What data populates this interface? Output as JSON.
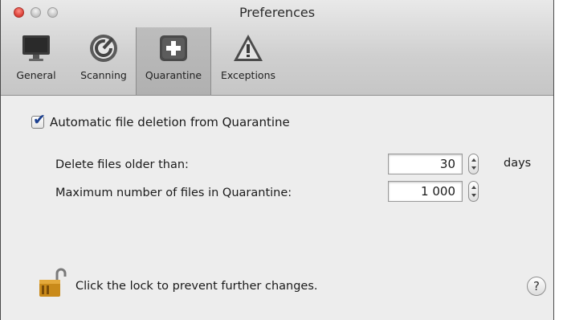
{
  "window": {
    "title": "Preferences"
  },
  "toolbar": {
    "items": [
      {
        "label": "General",
        "icon": "monitor-icon"
      },
      {
        "label": "Scanning",
        "icon": "scanning-icon"
      },
      {
        "label": "Quarantine",
        "icon": "quarantine-plus-icon",
        "selected": true
      },
      {
        "label": "Exceptions",
        "icon": "warning-triangle-icon"
      }
    ]
  },
  "quarantine": {
    "auto_delete_label": "Automatic file deletion from Quarantine",
    "auto_delete_checked": true,
    "delete_older_label": "Delete files older than:",
    "delete_older_value": "30",
    "delete_older_unit": "days",
    "max_files_label": "Maximum number of files in Quarantine:",
    "max_files_value": "1 000"
  },
  "footer": {
    "lock_text": "Click the lock to prevent further changes.",
    "help_label": "?"
  },
  "colors": {
    "checkmark": "#1b3f8f",
    "close_button": "#d93c33"
  }
}
